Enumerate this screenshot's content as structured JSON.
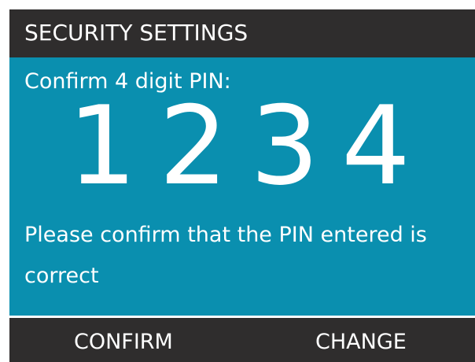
{
  "header": {
    "title": "SECURITY SETTINGS"
  },
  "content": {
    "prompt": "Confirm 4 digit PIN:",
    "pin_digits": [
      "1",
      "2",
      "3",
      "4"
    ],
    "message": "Please confirm that the PIN entered is correct"
  },
  "softkeys": {
    "left_label": "CONFIRM",
    "right_label": "CHANGE"
  },
  "colors": {
    "background_dark": "#2f2d2d",
    "content_accent": "#0a8faf",
    "text": "#ffffff"
  }
}
